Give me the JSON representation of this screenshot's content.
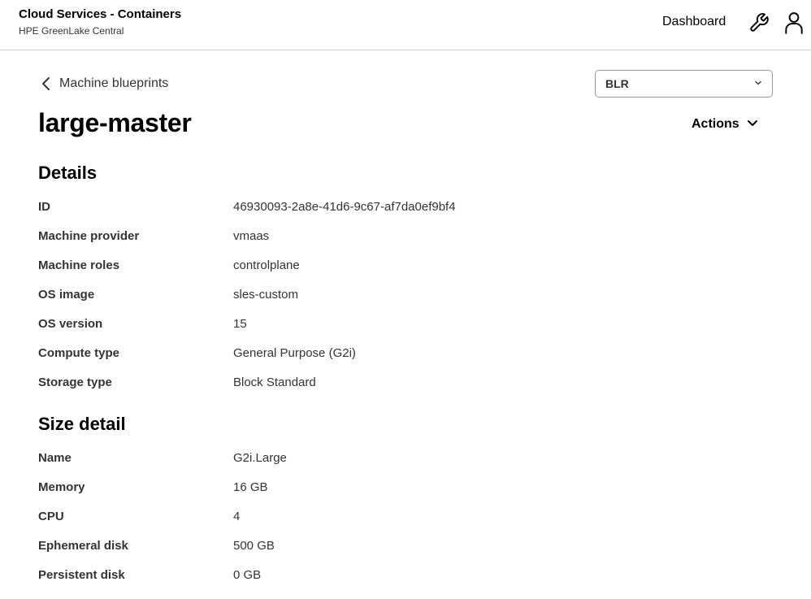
{
  "header": {
    "title": "Cloud Services - Containers",
    "subtitle": "HPE GreenLake Central",
    "nav_dashboard": "Dashboard",
    "tools_icon": "wrench-icon",
    "user_icon": "user-icon"
  },
  "breadcrumb": {
    "back_label": "Machine blueprints"
  },
  "location_select": {
    "value": "BLR"
  },
  "page": {
    "title": "large-master",
    "actions_label": "Actions"
  },
  "details": {
    "title": "Details",
    "rows": [
      {
        "label": "ID",
        "value": "46930093-2a8e-41d6-9c67-af7da0ef9bf4"
      },
      {
        "label": "Machine provider",
        "value": "vmaas"
      },
      {
        "label": "Machine roles",
        "value": "controlplane"
      },
      {
        "label": "OS image",
        "value": "sles-custom"
      },
      {
        "label": "OS version",
        "value": "15"
      },
      {
        "label": "Compute type",
        "value": "General Purpose (G2i)"
      },
      {
        "label": "Storage type",
        "value": "Block Standard"
      }
    ]
  },
  "size_detail": {
    "title": "Size detail",
    "rows": [
      {
        "label": "Name",
        "value": "G2i.Large"
      },
      {
        "label": "Memory",
        "value": "16 GB"
      },
      {
        "label": "CPU",
        "value": "4"
      },
      {
        "label": "Ephemeral disk",
        "value": "500 GB"
      },
      {
        "label": "Persistent disk",
        "value": "0 GB"
      }
    ]
  }
}
